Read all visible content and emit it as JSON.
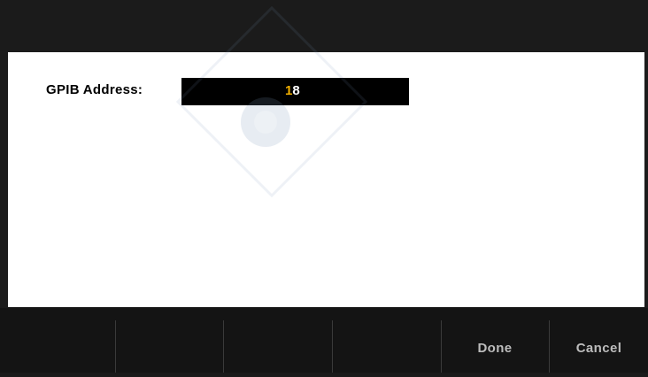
{
  "dialog": {
    "field_label": "GPIB Address:",
    "field_value_cursor_digit": "1",
    "field_value_rest": "8"
  },
  "softkeys": [
    {
      "label": ""
    },
    {
      "label": ""
    },
    {
      "label": ""
    },
    {
      "label": ""
    },
    {
      "label": "Done"
    },
    {
      "label": "Cancel"
    }
  ],
  "colors": {
    "cursor_digit": "#f2b000",
    "dialog_background": "#ffffff",
    "screen_background": "#1c1c1c"
  }
}
